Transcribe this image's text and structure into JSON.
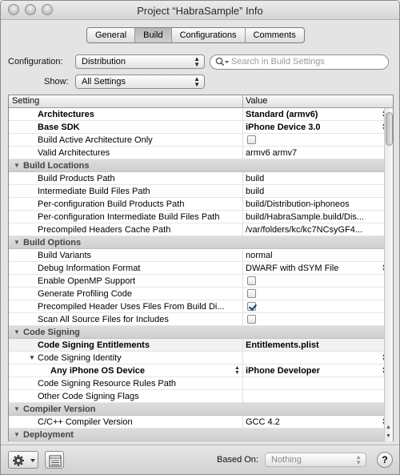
{
  "window": {
    "title": "Project “HabraSample” Info"
  },
  "tabs": [
    {
      "label": "General",
      "active": false
    },
    {
      "label": "Build",
      "active": true
    },
    {
      "label": "Configurations",
      "active": false
    },
    {
      "label": "Comments",
      "active": false
    }
  ],
  "filters": {
    "configuration_label": "Configuration:",
    "configuration_value": "Distribution",
    "show_label": "Show:",
    "show_value": "All Settings",
    "search_placeholder": "Search in Build Settings"
  },
  "table": {
    "col_setting": "Setting",
    "col_value": "Value",
    "rows": [
      {
        "type": "setting",
        "name": "Architectures",
        "value": "Standard (armv6)",
        "bold": true,
        "control": "stepper"
      },
      {
        "type": "setting",
        "name": "Base SDK",
        "value": "iPhone Device 3.0",
        "bold": true,
        "control": "stepper"
      },
      {
        "type": "setting",
        "name": "Build Active Architecture Only",
        "value": "",
        "control": "checkbox",
        "checked": false
      },
      {
        "type": "setting",
        "name": "Valid Architectures",
        "value": "armv6 armv7"
      },
      {
        "type": "group",
        "name": "Build Locations"
      },
      {
        "type": "setting",
        "name": "Build Products Path",
        "value": "build"
      },
      {
        "type": "setting",
        "name": "Intermediate Build Files Path",
        "value": "build"
      },
      {
        "type": "setting",
        "name": "Per-configuration Build Products Path",
        "value": "build/Distribution-iphoneos"
      },
      {
        "type": "setting",
        "name": "Per-configuration Intermediate Build Files Path",
        "value": "build/HabraSample.build/Dis..."
      },
      {
        "type": "setting",
        "name": "Precompiled Headers Cache Path",
        "value": "/var/folders/kc/kc7NCsyGF4..."
      },
      {
        "type": "group",
        "name": "Build Options"
      },
      {
        "type": "setting",
        "name": "Build Variants",
        "value": "normal"
      },
      {
        "type": "setting",
        "name": "Debug Information Format",
        "value": "DWARF with dSYM File",
        "control": "stepper"
      },
      {
        "type": "setting",
        "name": "Enable OpenMP Support",
        "value": "",
        "control": "checkbox",
        "checked": false
      },
      {
        "type": "setting",
        "name": "Generate Profiling Code",
        "value": "",
        "control": "checkbox",
        "checked": false
      },
      {
        "type": "setting",
        "name": "Precompiled Header Uses Files From Build Di...",
        "value": "",
        "control": "checkbox",
        "checked": true
      },
      {
        "type": "setting",
        "name": "Scan All Source Files for Includes",
        "value": "",
        "control": "checkbox",
        "checked": false
      },
      {
        "type": "group",
        "name": "Code Signing"
      },
      {
        "type": "setting",
        "name": "Code Signing Entitlements",
        "value": "Entitlements.plist",
        "bold": true,
        "highlight": true
      },
      {
        "type": "parent",
        "name": "Code Signing Identity",
        "value": "",
        "control": "stepper"
      },
      {
        "type": "child",
        "name": "Any iPhone OS Device",
        "value": "iPhone Developer",
        "bold": true,
        "control": "stepper",
        "name_stepper": true
      },
      {
        "type": "setting",
        "name": "Code Signing Resource Rules Path",
        "value": ""
      },
      {
        "type": "setting",
        "name": "Other Code Signing Flags",
        "value": ""
      },
      {
        "type": "group",
        "name": "Compiler Version"
      },
      {
        "type": "setting",
        "name": "C/C++ Compiler Version",
        "value": "GCC 4.2",
        "control": "stepper"
      },
      {
        "type": "group",
        "name": "Deployment"
      }
    ]
  },
  "bottom": {
    "based_on_label": "Based On:",
    "based_on_value": "Nothing",
    "help_label": "?"
  },
  "icons": {
    "action": "gear-icon",
    "config": "list-icon",
    "search": "search-icon"
  }
}
